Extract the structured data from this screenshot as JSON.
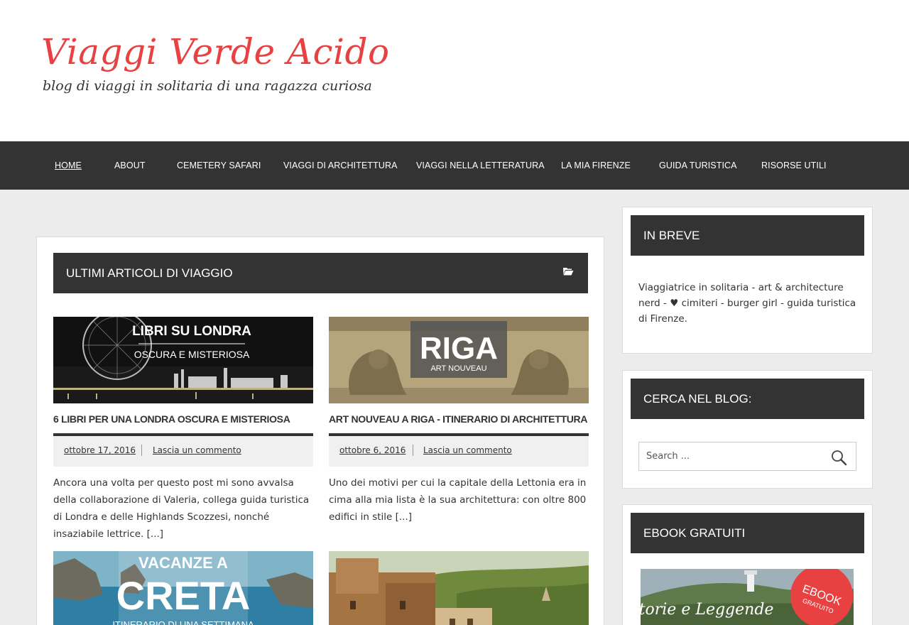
{
  "site": {
    "title": "Viaggi Verde Acido",
    "description": "blog di viaggi in solitaria di una ragazza curiosa"
  },
  "nav": [
    {
      "label": "HOME",
      "active": true
    },
    {
      "label": "ABOUT"
    },
    {
      "label": "CEMETERY SAFARI"
    },
    {
      "label": "VIAGGI DI ARCHITETTURA"
    },
    {
      "label": "VIAGGI NELLA LETTERATURA"
    },
    {
      "label": "LA MIA FIRENZE"
    },
    {
      "label": "GUIDA TURISTICA"
    },
    {
      "label": "RISORSE UTILI"
    }
  ],
  "main": {
    "section_title": "ULTIMI ARTICOLI DI VIAGGIO",
    "section_icon": "folder-open-icon",
    "posts": [
      {
        "image_text": [
          "LIBRI SU LONDRA",
          "OSCURA E MISTERIOSA"
        ],
        "title": "6 LIBRI PER UNA LONDRA OSCURA E MISTERIOSA",
        "date": "ottobre 17, 2016",
        "comments": "Lascia un commento",
        "excerpt": "Ancora una volta per questo post mi sono avvalsa della collaborazione di Valeria, collega guida turistica di Londra e delle Highlands Scozzesi, nonché insaziabile lettrice.",
        "more": "[...]"
      },
      {
        "image_text": [
          "RIGA",
          "ART NOUVEAU"
        ],
        "title": "ART NOUVEAU A RIGA - ITINERARIO DI ARCHITETTURA",
        "date": "ottobre 6, 2016",
        "comments": "Lascia un commento",
        "excerpt": "Uno dei motivi per cui la capitale della Lettonia era in cima alla mia lista è la sua architettura: con oltre 800 edifici in stile",
        "more": "[...]"
      },
      {
        "image_text": [
          "VACANZE A",
          "CRETA",
          "ITINERARIO DI UNA SETTIMANA"
        ]
      },
      {
        "image_text": []
      }
    ]
  },
  "sidebar": {
    "in_breve": {
      "title": "IN BREVE",
      "text": "Viaggiatrice in solitaria - art & architecture nerd - ♥ cimiteri - burger girl - guida turistica di Firenze."
    },
    "search": {
      "title": "CERCA NEL BLOG:",
      "placeholder": "Search ...",
      "button_icon": "search-icon"
    },
    "ebook": {
      "title": "EBOOK GRATUITI",
      "image_text": [
        "Storie e Leggende",
        "EBOOK",
        "GRATUITO"
      ]
    }
  },
  "colors": {
    "brand_red": "#e84141",
    "nav_bg": "#333333",
    "page_bg": "#ececec"
  }
}
